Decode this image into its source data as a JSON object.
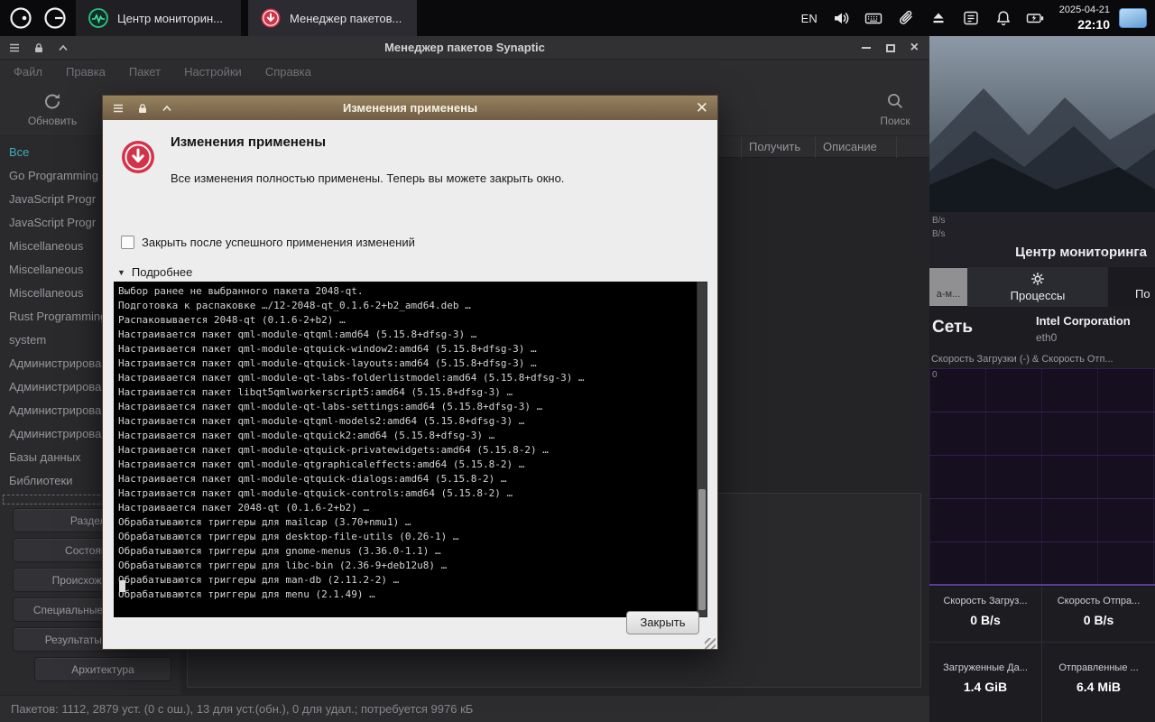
{
  "taskbar": {
    "lang": "EN",
    "date": "2025-04-21",
    "time": "22:10",
    "apps": [
      {
        "label": "Центр мониторин...",
        "icon": "monitor-icon"
      },
      {
        "label": "Менеджер пакетов...",
        "icon": "download-icon"
      }
    ]
  },
  "synaptic": {
    "title": "Менеджер пакетов Synaptic",
    "menus": [
      "Файл",
      "Правка",
      "Пакет",
      "Настройки",
      "Справка"
    ],
    "toolbar": {
      "refresh_label": "Обновить",
      "search_label": "Поиск"
    },
    "table_columns": [
      "Получить",
      "Описание"
    ],
    "categories": [
      "Все",
      "Go Programming",
      "JavaScript Progr",
      "JavaScript Progr",
      "Miscellaneous",
      "Miscellaneous",
      "Miscellaneous",
      "Rust Programming",
      "system",
      "Администрирова",
      "Администрирова",
      "Администрирова",
      "Администрирова",
      "Базы данных",
      "Библиотеки"
    ],
    "filter_buttons": [
      "Разделы",
      "Состояние",
      "Происхождение",
      "Специальные фильтры",
      "Результаты поиска",
      "Архитектура"
    ],
    "status": "Пакетов: 1112, 2879 уст. (0 с ош.), 13 для уст.(обн.), 0 для удал.; потребуется 9976 кБ"
  },
  "dialog": {
    "title": "Изменения применены",
    "heading": "Изменения применены",
    "message": "Все изменения полностью применены. Теперь вы можете закрыть окно.",
    "checkbox_label": "Закрыть после успешного применения изменений",
    "details_label": "Подробнее",
    "close_label": "Закрыть",
    "terminal_lines": [
      "Выбор ранее не выбранного пакета 2048-qt.",
      "Подготовка к распаковке …/12-2048-qt_0.1.6-2+b2_amd64.deb …",
      "Распаковывается 2048-qt (0.1.6-2+b2) …",
      "Настраивается пакет qml-module-qtqml:amd64 (5.15.8+dfsg-3) …",
      "Настраивается пакет qml-module-qtquick-window2:amd64 (5.15.8+dfsg-3) …",
      "Настраивается пакет qml-module-qtquick-layouts:amd64 (5.15.8+dfsg-3) …",
      "Настраивается пакет qml-module-qt-labs-folderlistmodel:amd64 (5.15.8+dfsg-3) …",
      "Настраивается пакет libqt5qmlworkerscript5:amd64 (5.15.8+dfsg-3) …",
      "Настраивается пакет qml-module-qt-labs-settings:amd64 (5.15.8+dfsg-3) …",
      "Настраивается пакет qml-module-qtqml-models2:amd64 (5.15.8+dfsg-3) …",
      "Настраивается пакет qml-module-qtquick2:amd64 (5.15.8+dfsg-3) …",
      "Настраивается пакет qml-module-qtquick-privatewidgets:amd64 (5.15.8-2) …",
      "Настраивается пакет qml-module-qtgraphicaleffects:amd64 (5.15.8-2) …",
      "Настраивается пакет qml-module-qtquick-dialogs:amd64 (5.15.8-2) …",
      "Настраивается пакет qml-module-qtquick-controls:amd64 (5.15.8-2) …",
      "Настраивается пакет 2048-qt (0.1.6-2+b2) …",
      "Обрабатываются триггеры для mailcap (3.70+nmu1) …",
      "Обрабатываются триггеры для desktop-file-utils (0.26-1) …",
      "Обрабатываются триггеры для gnome-menus (3.36.0-1.1) …",
      "Обрабатываются триггеры для libc-bin (2.36-9+deb12u8) …",
      "Обрабатываются триггеры для man-db (2.11.2-2) …",
      "Обрабатываются триггеры для menu (2.1.49) …"
    ]
  },
  "monitor": {
    "title": "Центр мониторинга",
    "axis_unit_labels": [
      "B/s",
      "B/s"
    ],
    "partial_tab_left": "а-м...",
    "tab_processes": "Процессы",
    "partial_tab_right": "По",
    "section_title": "Сеть",
    "adapter_name": "Intel Corporation",
    "adapter_device": "eth0",
    "chart_title": "Скорость Загрузки (-) & Скорость Отп...",
    "chart_zero_label": "0",
    "stats": [
      {
        "label": "Скорость Загруз...",
        "value": "0 B/s"
      },
      {
        "label": "Скорость Отпра...",
        "value": "0 B/s"
      },
      {
        "label": "Загруженные Да...",
        "value": "1.4 GiB"
      },
      {
        "label": "Отправленные ...",
        "value": "6.4 MiB"
      }
    ]
  }
}
